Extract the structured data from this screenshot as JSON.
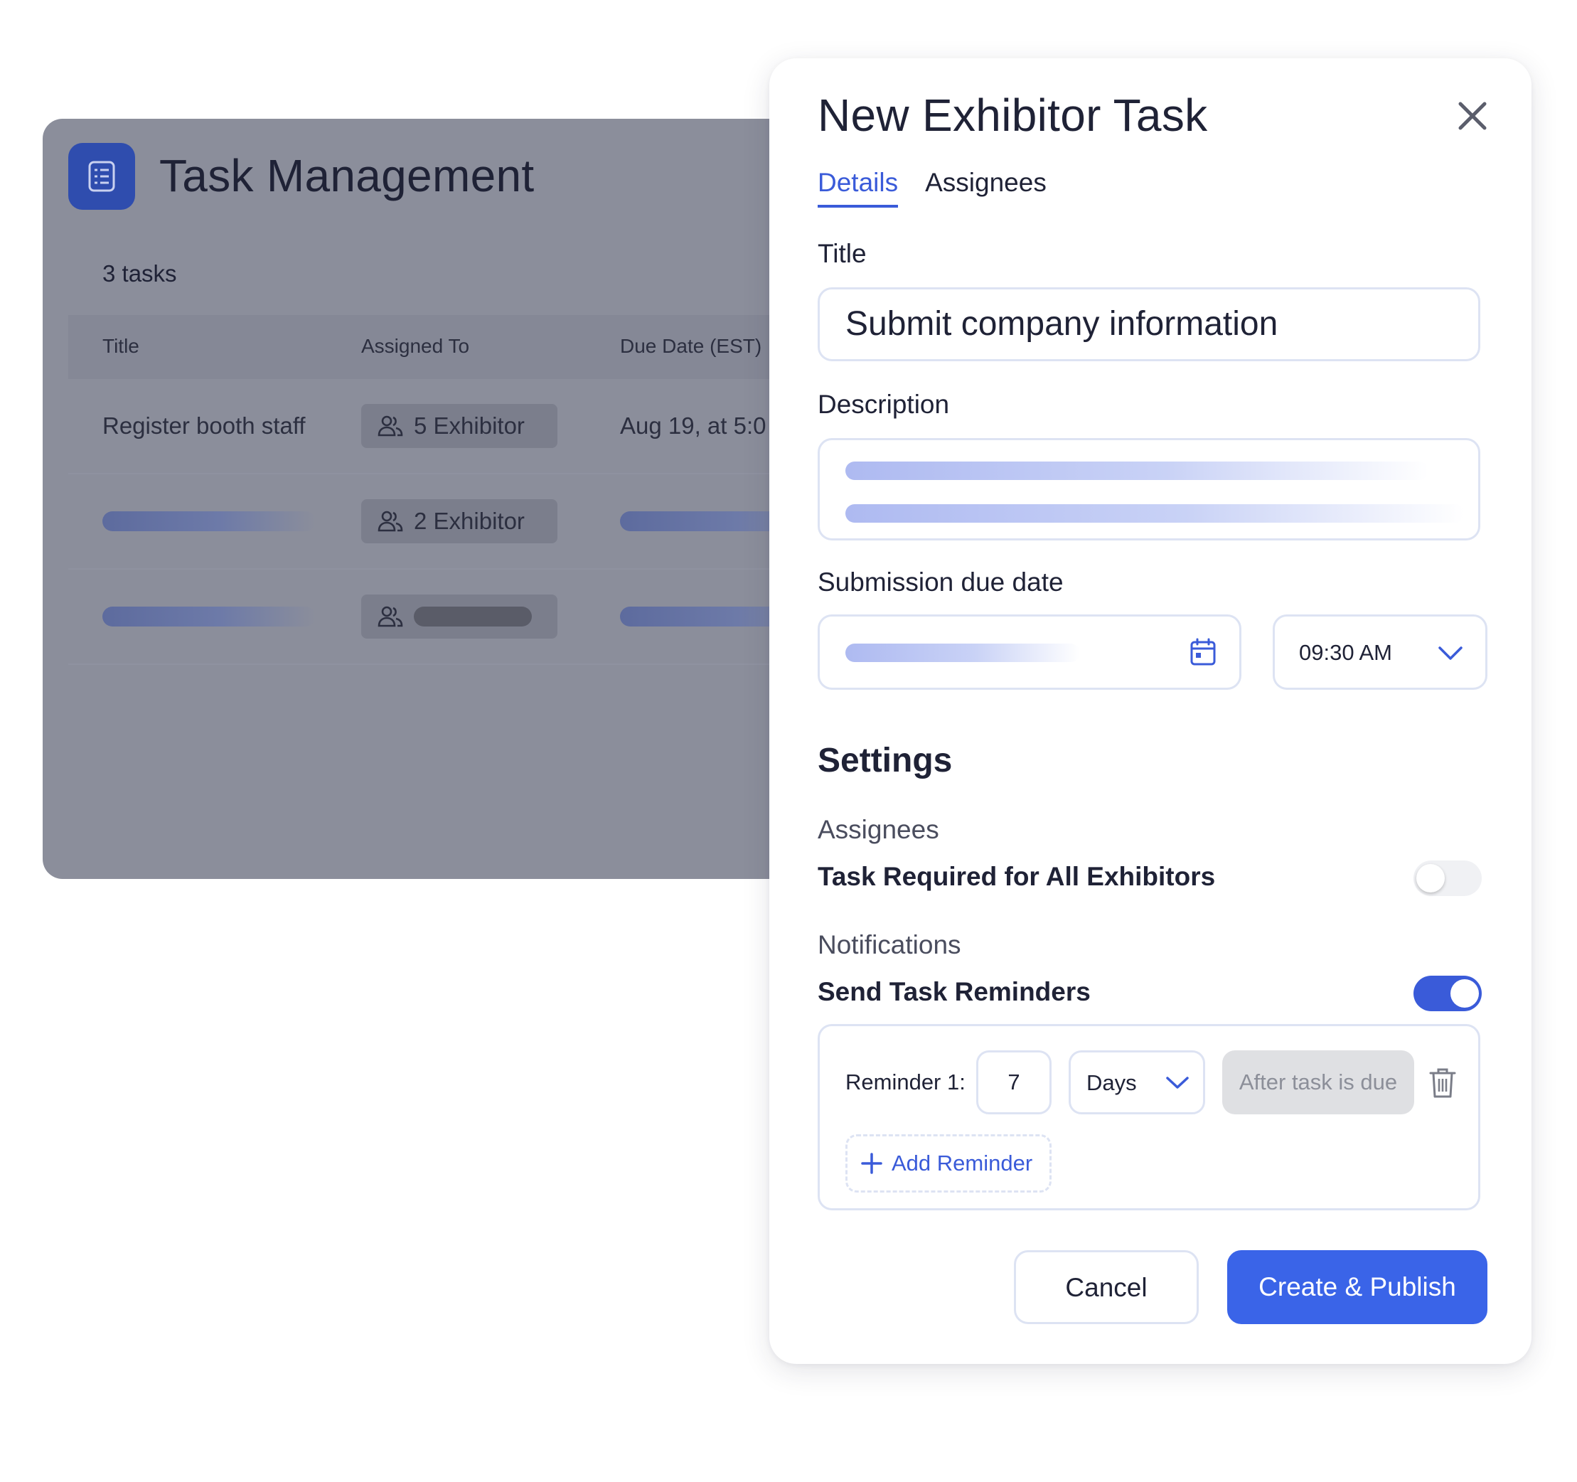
{
  "background_page": {
    "title": "Task Management",
    "task_count": "3 tasks",
    "columns": [
      "Title",
      "Assigned To",
      "Due Date (EST)"
    ],
    "rows": [
      {
        "title": "Register booth staff",
        "assigned": "5 Exhibitor",
        "due": "Aug 19, at 5:0"
      },
      {
        "title": "",
        "assigned": "2 Exhibitor",
        "due": ""
      },
      {
        "title": "",
        "assigned": "",
        "due": ""
      }
    ]
  },
  "modal": {
    "title": "New Exhibitor Task",
    "close_icon": "close-icon",
    "tabs": [
      {
        "label": "Details",
        "active": true
      },
      {
        "label": "Assignees",
        "active": false
      }
    ],
    "title_label": "Title",
    "title_value": "Submit company information",
    "description_label": "Description",
    "due_date_label": "Submission due date",
    "due_time": "09:30 AM",
    "settings": {
      "heading": "Settings",
      "assignees_label": "Assignees",
      "task_required_label": "Task Required for All Exhibitors",
      "task_required_on": false,
      "notifications_label": "Notifications",
      "send_reminders_label": "Send Task Reminders",
      "send_reminders_on": true
    },
    "reminder": {
      "label": "Reminder 1:",
      "value": "7",
      "unit": "Days",
      "when": "After task is due",
      "add_label": "Add Reminder"
    },
    "buttons": {
      "cancel": "Cancel",
      "primary": "Create & Publish"
    }
  },
  "colors": {
    "accent": "#3a5bd9",
    "primary_button": "#3a64e8",
    "overlay": "#8b8e9b"
  }
}
